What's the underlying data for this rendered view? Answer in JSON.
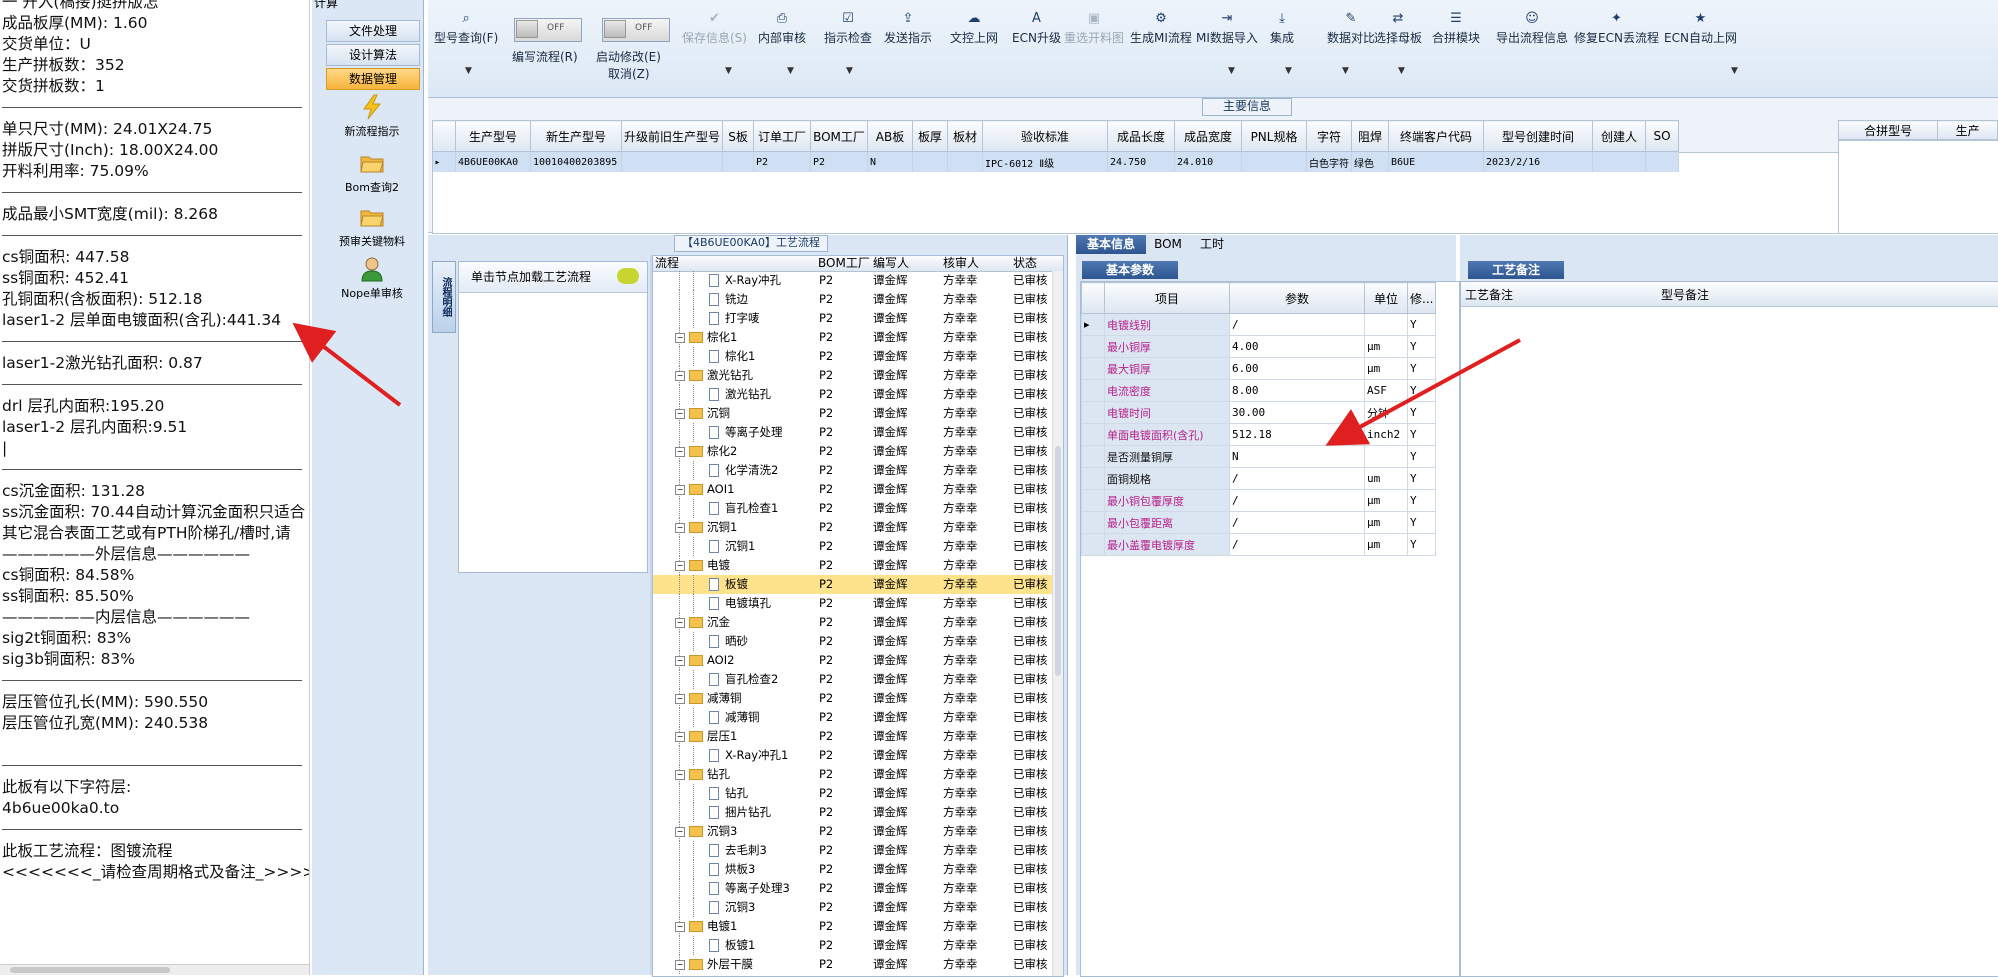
{
  "left_panel": {
    "lines": [
      {
        "text": "一 开入(稿接)挺拼版怎",
        "kind": "text"
      },
      {
        "text": "成品板厚(MM): 1.60",
        "kind": "text"
      },
      {
        "text": "交货单位：U",
        "kind": "text"
      },
      {
        "text": "生产拼板数：352",
        "kind": "text"
      },
      {
        "text": "交货拼板数：1",
        "kind": "text"
      },
      {
        "text": "",
        "kind": "sep"
      },
      {
        "text": "单只尺寸(MM): 24.01X24.75",
        "kind": "text"
      },
      {
        "text": "拼版尺寸(Inch): 18.00X24.00",
        "kind": "text"
      },
      {
        "text": "开料利用率: 75.09%",
        "kind": "text"
      },
      {
        "text": "",
        "kind": "sep"
      },
      {
        "text": "成品最小SMT宽度(mil): 8.268",
        "kind": "text"
      },
      {
        "text": "",
        "kind": "sep"
      },
      {
        "text": "cs铜面积: 447.58",
        "kind": "text"
      },
      {
        "text": "ss铜面积: 452.41",
        "kind": "text"
      },
      {
        "text": "孔铜面积(含板面积): 512.18",
        "kind": "text"
      },
      {
        "text": "laser1-2      层单面电镀面积(含孔):441.34",
        "kind": "text"
      },
      {
        "text": "",
        "kind": "sep"
      },
      {
        "text": "laser1-2激光钻孔面积: 0.87",
        "kind": "text"
      },
      {
        "text": "",
        "kind": "sep"
      },
      {
        "text": "drl            层孔内面积:195.20",
        "kind": "text"
      },
      {
        "text": "laser1-2      层孔内面积:9.51",
        "kind": "text"
      },
      {
        "text": "|",
        "kind": "text"
      },
      {
        "text": "",
        "kind": "sep"
      },
      {
        "text": "cs沉金面积: 131.28",
        "kind": "text"
      },
      {
        "text": "ss沉金面积: 70.44自动计算沉金面积只适合",
        "kind": "text"
      },
      {
        "text": "其它混合表面工艺或有PTH阶梯孔/槽时,请",
        "kind": "text"
      },
      {
        "text": "——————外层信息——————",
        "kind": "text"
      },
      {
        "text": "cs铜面积: 84.58%",
        "kind": "text"
      },
      {
        "text": "ss铜面积: 85.50%",
        "kind": "text"
      },
      {
        "text": "——————内层信息——————",
        "kind": "text"
      },
      {
        "text": "sig2t铜面积: 83%",
        "kind": "text"
      },
      {
        "text": "sig3b铜面积: 83%",
        "kind": "text"
      },
      {
        "text": "",
        "kind": "sep"
      },
      {
        "text": "层压管位孔长(MM): 590.550",
        "kind": "text"
      },
      {
        "text": "层压管位孔宽(MM): 240.538",
        "kind": "text"
      },
      {
        "text": "",
        "kind": "blank"
      },
      {
        "text": "",
        "kind": "sep"
      },
      {
        "text": "此板有以下字符层:",
        "kind": "text"
      },
      {
        "text": "4b6ue00ka0.to",
        "kind": "text"
      },
      {
        "text": "",
        "kind": "sep"
      },
      {
        "text": "此板工艺流程：图镀流程",
        "kind": "text"
      },
      {
        "text": "<<<<<<<_请检查周期格式及备注_>>>>",
        "kind": "text"
      }
    ]
  },
  "nav": {
    "top_fragment": "计算",
    "buttons": [
      {
        "label": "文件处理",
        "active": false
      },
      {
        "label": "设计算法",
        "active": false
      },
      {
        "label": "数据管理",
        "active": true
      }
    ],
    "icon_items": [
      {
        "label": "新流程指示",
        "icon": "lightning-icon"
      },
      {
        "label": "Bom查询2",
        "icon": "folder-open-icon"
      },
      {
        "label": "预审关键物料",
        "icon": "folder-open-icon"
      },
      {
        "label": "Nope单审核",
        "icon": "user-icon"
      }
    ]
  },
  "toolbar": {
    "items": [
      {
        "label": "型号查询(F)",
        "icon": "search-icon",
        "disabled": false,
        "dropdown": true
      },
      {
        "label": "保存信息(S)",
        "icon": "check-icon",
        "disabled": true,
        "dropdown": true
      },
      {
        "label": "内部审核",
        "icon": "printer-icon",
        "disabled": false,
        "dropdown": true
      },
      {
        "label": "指示检查",
        "icon": "checkbox-icon",
        "disabled": false,
        "dropdown": true
      },
      {
        "label": "发送指示",
        "icon": "upload-icon",
        "disabled": false,
        "dropdown": false
      },
      {
        "label": "文控上网",
        "icon": "cloud-upload-icon",
        "disabled": false,
        "dropdown": false
      },
      {
        "label": "ECN升级",
        "icon": "letter-a-icon",
        "disabled": false,
        "dropdown": false
      },
      {
        "label": "重选开料图",
        "icon": "image-icon",
        "disabled": true,
        "dropdown": false
      },
      {
        "label": "生成MI流程",
        "icon": "gears-icon",
        "disabled": false,
        "dropdown": false
      },
      {
        "label": "MI数据导入",
        "icon": "import-icon",
        "disabled": false,
        "dropdown": true
      },
      {
        "label": "集成",
        "icon": "download-icon",
        "disabled": false,
        "dropdown": true
      },
      {
        "label": "数据对比",
        "icon": "pin-icon",
        "disabled": false,
        "dropdown": true
      },
      {
        "label": "选择母板",
        "icon": "shuffle-icon",
        "disabled": false,
        "dropdown": true
      },
      {
        "label": "合拼模块",
        "icon": "list-icon",
        "disabled": false,
        "dropdown": false
      },
      {
        "label": "导出流程信息",
        "icon": "smiley-icon",
        "disabled": false,
        "dropdown": false
      },
      {
        "label": "修复ECN丢流程",
        "icon": "wrench-icon",
        "disabled": false,
        "dropdown": false
      },
      {
        "label": "ECN自动上网",
        "icon": "star-icon",
        "disabled": false,
        "dropdown": true
      }
    ],
    "toggles": [
      {
        "state": "OFF",
        "label": "编写流程(R)"
      },
      {
        "state": "OFF",
        "label": "启动修改(E)",
        "label2": "取消(Z)"
      }
    ]
  },
  "main_info": {
    "title": "主要信息",
    "columns": [
      "生产型号",
      "新生产型号",
      "升级前旧生产型号",
      "S板",
      "订单工厂",
      "BOM工厂",
      "AB板",
      "板厚",
      "板材",
      "验收标准",
      "成品长度",
      "成品宽度",
      "PNL规格",
      "字符",
      "阻焊",
      "终端客户代码",
      "型号创建时间",
      "创建人",
      "SO"
    ],
    "row": [
      "4B6UE00KA0",
      "10010400203895",
      "",
      "",
      "P2",
      "P2",
      "N",
      "",
      "",
      "IPC-6012 Ⅱ级",
      "24.750",
      "24.010",
      "",
      "白色字符",
      "绿色",
      "B6UE",
      "2023/2/16",
      "",
      ""
    ],
    "merge_columns": [
      "合拼型号",
      "生产"
    ]
  },
  "process": {
    "title": "【4B6UE00KA0】工艺流程",
    "side_tab": "流程明细",
    "load_text": "单击节点加载工艺流程",
    "columns": [
      "流程",
      "BOM工厂",
      "编写人",
      "核审人",
      "状态"
    ],
    "rows": [
      {
        "name": "X-Ray冲孔",
        "level": 2,
        "factory": "P2",
        "writer": "谭金辉",
        "reviewer": "方幸幸",
        "status": "已审核",
        "selected": false
      },
      {
        "name": "铣边",
        "level": 2,
        "factory": "P2",
        "writer": "谭金辉",
        "reviewer": "方幸幸",
        "status": "已审核",
        "selected": false
      },
      {
        "name": "打字唛",
        "level": 2,
        "factory": "P2",
        "writer": "谭金辉",
        "reviewer": "方幸幸",
        "status": "已审核",
        "selected": false
      },
      {
        "name": "棕化1",
        "level": 1,
        "factory": "P2",
        "writer": "谭金辉",
        "reviewer": "方幸幸",
        "status": "已审核",
        "selected": false
      },
      {
        "name": "棕化1",
        "level": 2,
        "factory": "P2",
        "writer": "谭金辉",
        "reviewer": "方幸幸",
        "status": "已审核",
        "selected": false
      },
      {
        "name": "激光钻孔",
        "level": 1,
        "factory": "P2",
        "writer": "谭金辉",
        "reviewer": "方幸幸",
        "status": "已审核",
        "selected": false
      },
      {
        "name": "激光钻孔",
        "level": 2,
        "factory": "P2",
        "writer": "谭金辉",
        "reviewer": "方幸幸",
        "status": "已审核",
        "selected": false
      },
      {
        "name": "沉铜",
        "level": 1,
        "factory": "P2",
        "writer": "谭金辉",
        "reviewer": "方幸幸",
        "status": "已审核",
        "selected": false
      },
      {
        "name": "等离子处理",
        "level": 2,
        "factory": "P2",
        "writer": "谭金辉",
        "reviewer": "方幸幸",
        "status": "已审核",
        "selected": false
      },
      {
        "name": "棕化2",
        "level": 1,
        "factory": "P2",
        "writer": "谭金辉",
        "reviewer": "方幸幸",
        "status": "已审核",
        "selected": false
      },
      {
        "name": "化学清洗2",
        "level": 2,
        "factory": "P2",
        "writer": "谭金辉",
        "reviewer": "方幸幸",
        "status": "已审核",
        "selected": false
      },
      {
        "name": "AOI1",
        "level": 1,
        "factory": "P2",
        "writer": "谭金辉",
        "reviewer": "方幸幸",
        "status": "已审核",
        "selected": false
      },
      {
        "name": "盲孔检查1",
        "level": 2,
        "factory": "P2",
        "writer": "谭金辉",
        "reviewer": "方幸幸",
        "status": "已审核",
        "selected": false
      },
      {
        "name": "沉铜1",
        "level": 1,
        "factory": "P2",
        "writer": "谭金辉",
        "reviewer": "方幸幸",
        "status": "已审核",
        "selected": false
      },
      {
        "name": "沉铜1",
        "level": 2,
        "factory": "P2",
        "writer": "谭金辉",
        "reviewer": "方幸幸",
        "status": "已审核",
        "selected": false
      },
      {
        "name": "电镀",
        "level": 1,
        "factory": "P2",
        "writer": "谭金辉",
        "reviewer": "方幸幸",
        "status": "已审核",
        "selected": false
      },
      {
        "name": "板镀",
        "level": 2,
        "factory": "P2",
        "writer": "谭金辉",
        "reviewer": "方幸幸",
        "status": "已审核",
        "selected": true
      },
      {
        "name": "电镀填孔",
        "level": 2,
        "factory": "P2",
        "writer": "谭金辉",
        "reviewer": "方幸幸",
        "status": "已审核",
        "selected": false
      },
      {
        "name": "沉金",
        "level": 1,
        "factory": "P2",
        "writer": "谭金辉",
        "reviewer": "方幸幸",
        "status": "已审核",
        "selected": false
      },
      {
        "name": "晒砂",
        "level": 2,
        "factory": "P2",
        "writer": "谭金辉",
        "reviewer": "方幸幸",
        "status": "已审核",
        "selected": false
      },
      {
        "name": "AOI2",
        "level": 1,
        "factory": "P2",
        "writer": "谭金辉",
        "reviewer": "方幸幸",
        "status": "已审核",
        "selected": false
      },
      {
        "name": "盲孔检查2",
        "level": 2,
        "factory": "P2",
        "writer": "谭金辉",
        "reviewer": "方幸幸",
        "status": "已审核",
        "selected": false
      },
      {
        "name": "减薄铜",
        "level": 1,
        "factory": "P2",
        "writer": "谭金辉",
        "reviewer": "方幸幸",
        "status": "已审核",
        "selected": false
      },
      {
        "name": "减薄铜",
        "level": 2,
        "factory": "P2",
        "writer": "谭金辉",
        "reviewer": "方幸幸",
        "status": "已审核",
        "selected": false
      },
      {
        "name": "层压1",
        "level": 1,
        "factory": "P2",
        "writer": "谭金辉",
        "reviewer": "方幸幸",
        "status": "已审核",
        "selected": false
      },
      {
        "name": "X-Ray冲孔1",
        "level": 2,
        "factory": "P2",
        "writer": "谭金辉",
        "reviewer": "方幸幸",
        "status": "已审核",
        "selected": false
      },
      {
        "name": "钻孔",
        "level": 1,
        "factory": "P2",
        "writer": "谭金辉",
        "reviewer": "方幸幸",
        "status": "已审核",
        "selected": false
      },
      {
        "name": "钻孔",
        "level": 2,
        "factory": "P2",
        "writer": "谭金辉",
        "reviewer": "方幸幸",
        "status": "已审核",
        "selected": false
      },
      {
        "name": "捆片钻孔",
        "level": 2,
        "factory": "P2",
        "writer": "谭金辉",
        "reviewer": "方幸幸",
        "status": "已审核",
        "selected": false
      },
      {
        "name": "沉铜3",
        "level": 1,
        "factory": "P2",
        "writer": "谭金辉",
        "reviewer": "方幸幸",
        "status": "已审核",
        "selected": false
      },
      {
        "name": "去毛刺3",
        "level": 2,
        "factory": "P2",
        "writer": "谭金辉",
        "reviewer": "方幸幸",
        "status": "已审核",
        "selected": false
      },
      {
        "name": "烘板3",
        "level": 2,
        "factory": "P2",
        "writer": "谭金辉",
        "reviewer": "方幸幸",
        "status": "已审核",
        "selected": false
      },
      {
        "name": "等离子处理3",
        "level": 2,
        "factory": "P2",
        "writer": "谭金辉",
        "reviewer": "方幸幸",
        "status": "已审核",
        "selected": false
      },
      {
        "name": "沉铜3",
        "level": 2,
        "factory": "P2",
        "writer": "谭金辉",
        "reviewer": "方幸幸",
        "status": "已审核",
        "selected": false
      },
      {
        "name": "电镀1",
        "level": 1,
        "factory": "P2",
        "writer": "谭金辉",
        "reviewer": "方幸幸",
        "status": "已审核",
        "selected": false
      },
      {
        "name": "板镀1",
        "level": 2,
        "factory": "P2",
        "writer": "谭金辉",
        "reviewer": "方幸幸",
        "status": "已审核",
        "selected": false
      },
      {
        "name": "外层干膜",
        "level": 1,
        "factory": "P2",
        "writer": "谭金辉",
        "reviewer": "方幸幸",
        "status": "已审核",
        "selected": false
      }
    ]
  },
  "basic_info": {
    "tabs": [
      "基本信息",
      "BOM",
      "工时"
    ],
    "subtab": "基本参数",
    "columns": [
      "项目",
      "参数",
      "单位",
      "修..."
    ],
    "rows": [
      {
        "name": "电镀线别",
        "value": "/",
        "unit": "",
        "flag": "Y",
        "color": "magenta"
      },
      {
        "name": "最小铜厚",
        "value": "4.00",
        "unit": "μm",
        "flag": "Y",
        "color": "magenta"
      },
      {
        "name": "最大铜厚",
        "value": "6.00",
        "unit": "μm",
        "flag": "Y",
        "color": "magenta"
      },
      {
        "name": "电流密度",
        "value": "8.00",
        "unit": "ASF",
        "flag": "Y",
        "color": "magenta"
      },
      {
        "name": "电镀时间",
        "value": "30.00",
        "unit": "分钟",
        "flag": "Y",
        "color": "magenta"
      },
      {
        "name": "单面电镀面积(含孔)",
        "value": "512.18",
        "unit": "inch2",
        "flag": "Y",
        "color": "magenta"
      },
      {
        "name": "是否测量铜厚",
        "value": "N",
        "unit": "",
        "flag": "Y",
        "color": "black"
      },
      {
        "name": "面铜规格",
        "value": "/",
        "unit": "um",
        "flag": "Y",
        "color": "black"
      },
      {
        "name": "最小铜包覆厚度",
        "value": "/",
        "unit": "μm",
        "flag": "Y",
        "color": "magenta"
      },
      {
        "name": "最小包覆距离",
        "value": "/",
        "unit": "μm",
        "flag": "Y",
        "color": "magenta"
      },
      {
        "name": "最小盖覆电镀厚度",
        "value": "/",
        "unit": "μm",
        "flag": "Y",
        "color": "magenta"
      }
    ]
  },
  "remark": {
    "tab": "工艺备注",
    "columns": [
      "工艺备注",
      "型号备注"
    ]
  },
  "colors": {
    "accent_tab": "#2d558f",
    "highlight_row": "#ffe28c",
    "arrow": "#e02020",
    "magenta_text": "#b8208a"
  }
}
